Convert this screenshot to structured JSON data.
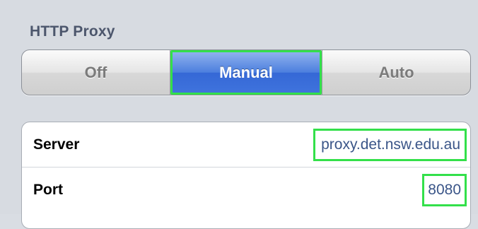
{
  "section": {
    "title": "HTTP Proxy"
  },
  "proxy_mode": {
    "options": [
      "Off",
      "Manual",
      "Auto"
    ],
    "selected": "Manual"
  },
  "settings": {
    "server": {
      "label": "Server",
      "value": "proxy.det.nsw.edu.au"
    },
    "port": {
      "label": "Port",
      "value": "8080"
    }
  },
  "colors": {
    "selected_segment": "#3f73dd",
    "value_text": "#3a5588",
    "highlight_border": "#33e04a",
    "section_title": "#4c566c"
  }
}
